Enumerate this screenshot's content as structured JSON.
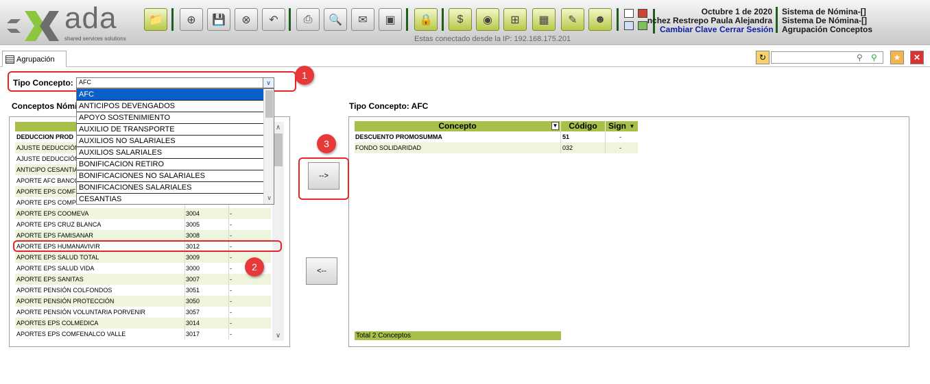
{
  "header": {
    "brand": "ada",
    "tagline": "shared services solutions",
    "connection": "Estas conectado desde la IP: 192.168.175.201",
    "date": "Octubre 1 de 2020",
    "user": "nchez Restrepo Paula Alejandra",
    "links": {
      "change_password": "Cambiar Clave",
      "logout": "Cerrar Sesión"
    },
    "system_lines": [
      "Sistema de Nómina-[]",
      "Sistema De Nómina-[]",
      "Agrupación Conceptos"
    ],
    "toolbar_icons": [
      "folder-icon",
      "new-icon",
      "save-icon",
      "delete-icon",
      "undo-icon",
      "print-icon",
      "preview-icon",
      "export-icon",
      "briefcase-icon",
      "lock-icon",
      "money-icon",
      "camera-icon",
      "grid-icon",
      "cart-icon",
      "edit-icon",
      "users-icon"
    ]
  },
  "tab": {
    "label": "Agrupación"
  },
  "form": {
    "tipo_concepto_label": "Tipo Concepto:",
    "selected_value": "AFC",
    "options": [
      "AFC",
      "ANTICIPOS DEVENGADOS",
      "APOYO SOSTENIMIENTO",
      "AUXILIO DE TRANSPORTE",
      "AUXILIOS NO SALARIALES",
      "AUXILIOS SALARIALES",
      "BONIFICACION RETIRO",
      "BONIFICACIONES NO SALARIALES",
      "BONIFICACIONES SALARIALES",
      "CESANTIAS"
    ]
  },
  "left": {
    "title": "Conceptos Nómi",
    "header_partial": "DEDUCCION  PROD",
    "rows": [
      {
        "name": "AJUSTE DEDUCCIÓN",
        "code": "",
        "sign": ""
      },
      {
        "name": "AJUSTE DEDUCCIÓN",
        "code": "",
        "sign": ""
      },
      {
        "name": "ANTICIPO CESANTIA",
        "code": "",
        "sign": ""
      },
      {
        "name": "APORTE AFC BANCO",
        "code": "",
        "sign": ""
      },
      {
        "name": "APORTE EPS COMFE",
        "code": "",
        "sign": ""
      },
      {
        "name": "APORTE EPS COMPE",
        "code": "",
        "sign": ""
      },
      {
        "name": "APORTE EPS COOMEVA",
        "code": "3004",
        "sign": "-"
      },
      {
        "name": "APORTE EPS CRUZ BLANCA",
        "code": "3005",
        "sign": "-"
      },
      {
        "name": "APORTE EPS FAMISANAR",
        "code": "3008",
        "sign": "-"
      },
      {
        "name": "APORTE EPS HUMANAVIVIR",
        "code": "3012",
        "sign": "-"
      },
      {
        "name": "APORTE EPS SALUD TOTAL",
        "code": "3009",
        "sign": "-"
      },
      {
        "name": "APORTE EPS SALUD VIDA",
        "code": "3000",
        "sign": "-"
      },
      {
        "name": "APORTE EPS SANITAS",
        "code": "3007",
        "sign": "-"
      },
      {
        "name": "APORTE PENSIÓN COLFONDOS",
        "code": "3051",
        "sign": "-"
      },
      {
        "name": "APORTE PENSIÓN PROTECCIÓN",
        "code": "3050",
        "sign": "-"
      },
      {
        "name": "APORTE PENSIÓN VOLUNTARIA PORVENIR",
        "code": "3057",
        "sign": "-"
      },
      {
        "name": "APORTES EPS COLMEDICA",
        "code": "3014",
        "sign": "-"
      },
      {
        "name": "APORTES EPS COMFENALCO VALLE",
        "code": "3017",
        "sign": "-"
      }
    ]
  },
  "buttons": {
    "add": "-->",
    "remove": "<--"
  },
  "right": {
    "title": "Tipo Concepto: AFC",
    "columns": {
      "concept": "Concepto",
      "code": "Código",
      "sign": "Sign"
    },
    "rows": [
      {
        "name": "DESCUENTO PROMOSUMMA",
        "code": "51",
        "sign": "-"
      },
      {
        "name": "FONDO SOLIDARIDAD",
        "code": "032",
        "sign": "-"
      }
    ],
    "total": "Total 2 Conceptos"
  },
  "annotations": [
    "1",
    "2",
    "3"
  ],
  "colors": {
    "accent_green": "#a8c04a",
    "row_alt": "#eef5dc",
    "highlight_red": "#e8232a",
    "selected_blue": "#0a5fc9"
  }
}
